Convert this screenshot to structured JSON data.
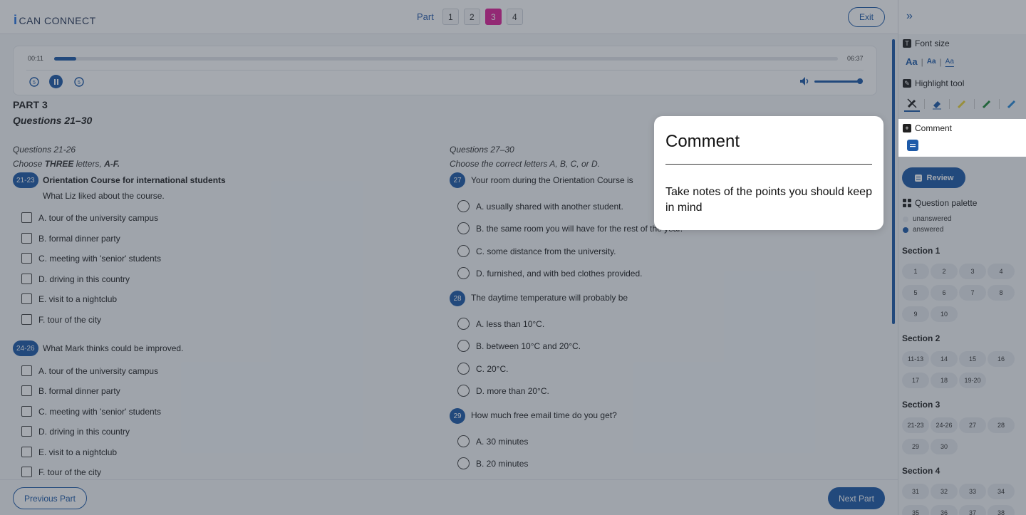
{
  "header": {
    "logo_text": "CAN CONNECT",
    "logo_mark": "i",
    "part_label": "Part",
    "parts": [
      "1",
      "2",
      "3",
      "4"
    ],
    "active_part": "3",
    "exit_label": "Exit"
  },
  "player": {
    "elapsed": "00:11",
    "total": "06:37",
    "progress_fraction": 0.028,
    "volume_fraction": 1.0,
    "rewind_label": "5",
    "forward_label": "5"
  },
  "content": {
    "part_title": "PART 3",
    "questions_range": "Questions 21–30",
    "left": {
      "instr1": "Questions 21-26",
      "instr2_pre": "Choose ",
      "instr2_bold": "THREE",
      "instr2_mid": " letters, ",
      "instr2_bold2": "A-F.",
      "group1": {
        "badge": "21-23",
        "title": "Orientation Course for international students",
        "prompt": "What Liz liked about the course.",
        "options": [
          "A. tour of the university campus",
          "B. formal dinner party",
          "C. meeting with 'senior' students",
          "D. driving in this country",
          "E. visit to a nightclub",
          "F. tour of the city"
        ]
      },
      "group2": {
        "badge": "24-26",
        "prompt": "What Mark thinks could be improved.",
        "options": [
          "A. tour of the university campus",
          "B. formal dinner party",
          "C. meeting with 'senior' students",
          "D. driving in this country",
          "E. visit to a nightclub",
          "F. tour of the city"
        ]
      }
    },
    "right": {
      "instr1": "Questions 27–30",
      "instr2": "Choose the correct letters A, B, C, or D.",
      "q27": {
        "badge": "27",
        "text": "Your room during the Orientation Course is",
        "options": [
          "A. usually shared with another student.",
          "B. the same room you will have for the rest of the year.",
          "C. some distance from the university.",
          "D. furnished, and with bed clothes provided."
        ]
      },
      "q28": {
        "badge": "28",
        "text": "The daytime temperature will probably be",
        "options": [
          "A. less than 10°C.",
          "B. between 10°C and 20°C.",
          "C. 20°C.",
          "D. more than 20°C."
        ]
      },
      "q29": {
        "badge": "29",
        "text": "How much free email time do you get?",
        "options": [
          "A. 30 minutes",
          "B. 20 minutes"
        ]
      }
    }
  },
  "footer": {
    "prev_label": "Previous Part",
    "next_label": "Next Part"
  },
  "sidebar": {
    "font_size_title": "Font size",
    "font_sizes": [
      "Aa",
      "Aa",
      "Aa"
    ],
    "highlight_title": "Highlight tool",
    "comment_title": "Comment",
    "review_label": "Review",
    "palette_title": "Question palette",
    "legend_unanswered": "unanswered",
    "legend_answered": "answered",
    "sections": [
      {
        "title": "Section 1",
        "items": [
          "1",
          "2",
          "3",
          "4",
          "5",
          "6",
          "7",
          "8",
          "9",
          "10"
        ]
      },
      {
        "title": "Section 2",
        "items": [
          "11-13",
          "14",
          "15",
          "16",
          "17",
          "18",
          "19-20"
        ]
      },
      {
        "title": "Section 3",
        "items": [
          "21-23",
          "24-26",
          "27",
          "28",
          "29",
          "30"
        ]
      },
      {
        "title": "Section 4",
        "items": [
          "31",
          "32",
          "33",
          "34",
          "35",
          "36",
          "37",
          "38"
        ]
      }
    ]
  },
  "modal": {
    "title": "Comment",
    "body": "Take notes of the points you should keep in mind"
  },
  "colors": {
    "accent": "#1e5aa8",
    "active_part": "#e0249a",
    "overlay": "rgba(40,50,65,0.42)"
  }
}
